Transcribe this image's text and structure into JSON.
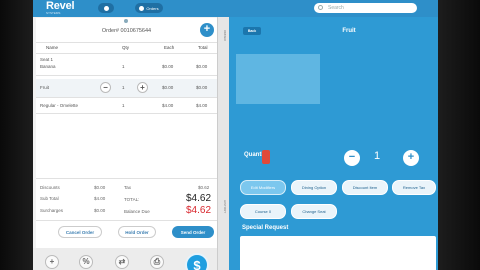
{
  "app": {
    "logo": "Revel",
    "logo_sub": "SYSTEMS"
  },
  "topbar": {
    "nav_label": "Orders",
    "search_placeholder": "Search"
  },
  "order": {
    "number_label": "Order# 0010675644",
    "headers": {
      "name": "Name",
      "qty": "Qty",
      "each": "Each",
      "total": "Total"
    },
    "rows": [
      {
        "name": "Seat 1",
        "sub": "Banana",
        "qty": "1",
        "each": "$0.00",
        "total": "$0.00"
      },
      {
        "name": "Fruit",
        "qty": "1",
        "each": "$0.00",
        "total": "$0.00"
      },
      {
        "name": "Regular - Omelette",
        "qty": "1",
        "each": "$4.00",
        "total": "$4.00"
      }
    ],
    "totals": {
      "discounts_label": "Discounts",
      "discounts": "$0.00",
      "subtotal_label": "Sub Total",
      "subtotal": "$4.00",
      "surcharges_label": "Surcharges",
      "surcharges": "$0.00",
      "tax_label": "Tax",
      "tax": "$0.62",
      "total_label": "TOTAL:",
      "total": "$4.62",
      "balance_label": "Balance Due",
      "balance": "$4.62"
    },
    "buttons": {
      "cancel": "Cancel Order",
      "hold": "Hold Order",
      "send": "Send Order"
    }
  },
  "iconbar": {
    "add": "+",
    "percent": "%",
    "split": "⇄",
    "print": "⎙",
    "pay": "$"
  },
  "panel": {
    "back": "Back",
    "title": "Fruit",
    "quantity_label": "Quantity",
    "quantity": "1",
    "minus": "−",
    "plus": "+",
    "side_label_top": "ORDER",
    "side_label_bottom": "HISTORY",
    "modifiers": [
      {
        "label": "Edit Modifiers",
        "selected": true
      },
      {
        "label": "Dining Option",
        "selected": false
      },
      {
        "label": "Discount Item",
        "selected": false
      },
      {
        "label": "Remove Tax",
        "selected": false
      },
      {
        "label": "Course 0",
        "selected": false
      },
      {
        "label": "Change Seat",
        "selected": false
      }
    ],
    "special_request_label": "Special Request"
  },
  "colors": {
    "brand": "#2e8fc9",
    "panel": "#2e9ad4",
    "total_red": "#d9272e"
  }
}
